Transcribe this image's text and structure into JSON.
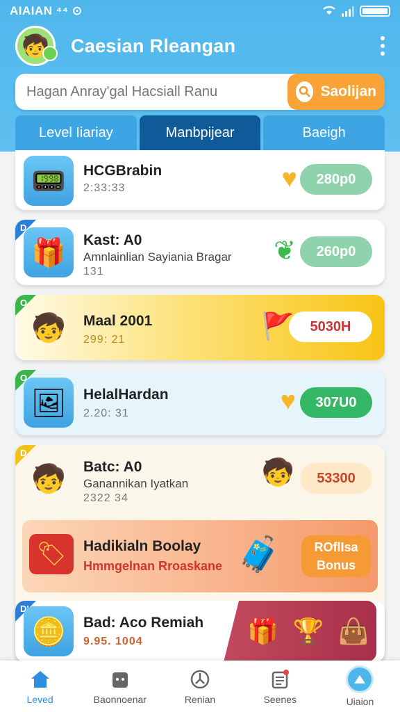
{
  "status_bar": {
    "time": "AIAIAN ⁴⁴ ⊙"
  },
  "header": {
    "title": "Caesian Rleangan"
  },
  "search": {
    "placeholder": "Hagan Anray'gal Hacsiall Ranu",
    "button_label": "Saolijan"
  },
  "tabs": [
    {
      "label": "Level Iiariay",
      "active": false
    },
    {
      "label": "Manbpijear",
      "active": true
    },
    {
      "label": "Baeigh",
      "active": false
    }
  ],
  "list": [
    {
      "title": "HCGBrabin",
      "subtitle": "",
      "meta": "2:33:33",
      "pill": "280p0",
      "badge": ""
    },
    {
      "title": "Kast: A0",
      "subtitle": "Amnlainlian Sayiania Bragar",
      "meta": "131",
      "pill": "260p0",
      "badge": "D"
    },
    {
      "title": "Maal 2001",
      "subtitle": "",
      "meta": "299: 21",
      "pill": "5030H",
      "badge": "O"
    },
    {
      "title": "HelalHardan",
      "subtitle": "",
      "meta": "2.20: 31",
      "pill": "307U0",
      "badge": "O"
    },
    {
      "title": "Batc: A0",
      "subtitle": "Ganannikan Iyatkan",
      "meta": "2322 34",
      "pill": "53300",
      "badge": "D"
    }
  ],
  "promo": {
    "title": "Hadikialn Boolay",
    "subtitle": "Hmmgelnan Rroaskane",
    "button_top": "ROflIsa",
    "button_bottom": "Bonus"
  },
  "reward": {
    "title": "Bad: Aco Remiah",
    "meta": "9.95. 1004",
    "badge": "D'"
  },
  "bottom_nav": [
    {
      "label": "Leved",
      "icon": "home-icon",
      "active": true
    },
    {
      "label": "Baonnoenar",
      "icon": "cat-icon",
      "active": false
    },
    {
      "label": "Renian",
      "icon": "compass-icon",
      "active": false
    },
    {
      "label": "Seenes",
      "icon": "notes-icon",
      "active": false
    },
    {
      "label": "Uiaion",
      "icon": "profile-icon",
      "active": false
    }
  ]
}
